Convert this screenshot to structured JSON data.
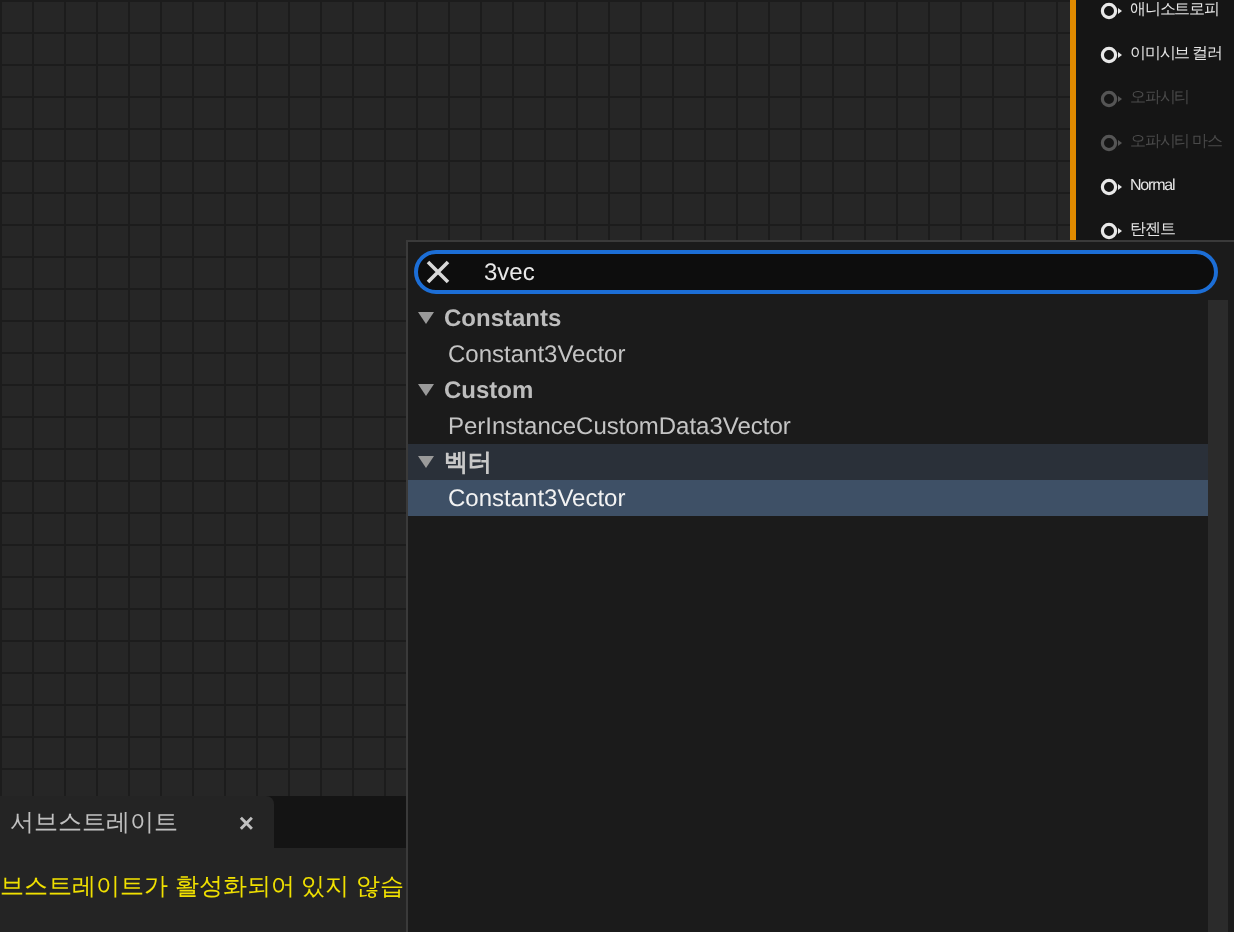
{
  "node_pins": [
    {
      "label": "애니소트로피",
      "disabled": false
    },
    {
      "label": "이미시브 컬러",
      "disabled": false
    },
    {
      "label": "오파시티",
      "disabled": true
    },
    {
      "label": "오파시티 마스",
      "disabled": true
    },
    {
      "label": "Normal",
      "disabled": false
    },
    {
      "label": "탄젠트",
      "disabled": false
    }
  ],
  "search": {
    "value": "3vec"
  },
  "categories": [
    {
      "label": "Constants",
      "expanded": true,
      "items": [
        {
          "label": "Constant3Vector",
          "selected": false
        }
      ]
    },
    {
      "label": "Custom",
      "expanded": true,
      "items": [
        {
          "label": "PerInstanceCustomData3Vector",
          "selected": false
        }
      ]
    },
    {
      "label": "벡터",
      "expanded": true,
      "items": [
        {
          "label": "Constant3Vector",
          "selected": true
        }
      ]
    }
  ],
  "bottom_panel": {
    "tab": {
      "label": "서브스트레이트",
      "close": "×"
    },
    "message": "브스트레이트가 활성화되어 있지 않습"
  }
}
